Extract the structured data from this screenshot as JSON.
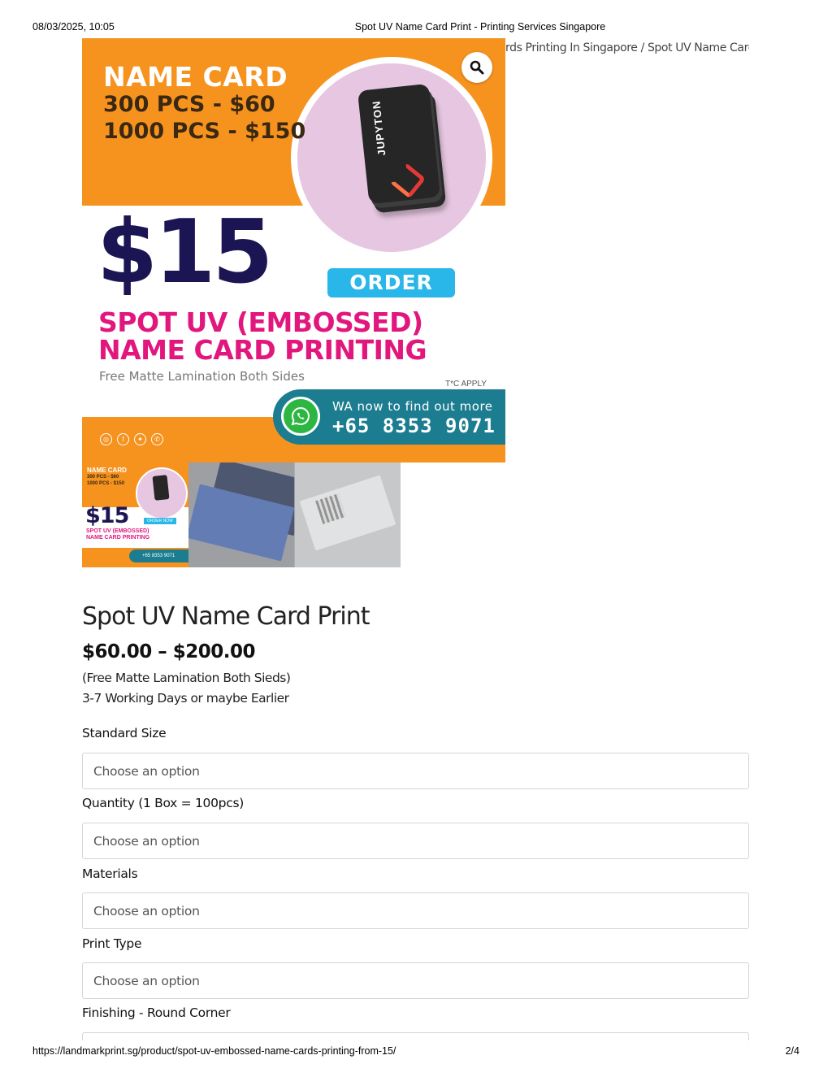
{
  "print_header": {
    "datetime": "08/03/2025, 10:05",
    "page_title": "Spot UV Name Card Print - Printing Services Singapore"
  },
  "breadcrumb": {
    "text": "rds Printing In Singapore / Spot UV Name Card"
  },
  "banner": {
    "title": "NAME CARD",
    "line1": "300 PCS - $60",
    "line2": "1000 PCS - $150",
    "card_brand": "JUPYTON",
    "price": "$15",
    "order_label": "ORDER NOW",
    "spot_line1": "SPOT UV (EMBOSSED)",
    "spot_line2": "NAME CARD PRINTING",
    "free_text": "Free Matte Lamination Both Sides",
    "tc_text": "T*C APPLY",
    "wa_line1": "WA now to find out more",
    "wa_line2": "+65 8353 9071",
    "colors": {
      "orange": "#f6931f",
      "navy": "#1c1554",
      "magenta": "#e2177e",
      "cyan": "#29b6e8",
      "teal": "#1b7d8f"
    }
  },
  "thumbnail1": {
    "title": "NAME CARD",
    "line1": "300 PCS - $60",
    "line2": "1000 PCS - $150",
    "price": "$15",
    "order": "ORDER NOW",
    "spot1": "SPOT UV (EMBOSSED)",
    "spot2": "NAME CARD PRINTING",
    "wa": "+65 8353 9071"
  },
  "product": {
    "title": "Spot UV Name Card Print",
    "price_range": "$60.00 – $200.00",
    "note1": "(Free Matte Lamination Both Sieds)",
    "note2": "3-7 Working Days or maybe Earlier"
  },
  "options": [
    {
      "label": "Standard Size",
      "placeholder": "Choose an option"
    },
    {
      "label": "Quantity (1 Box = 100pcs)",
      "placeholder": "Choose an option"
    },
    {
      "label": "Materials",
      "placeholder": "Choose an option"
    },
    {
      "label": "Print Type",
      "placeholder": "Choose an option"
    },
    {
      "label": "Finishing - Round Corner",
      "placeholder": ""
    }
  ],
  "print_footer": {
    "url": "https://landmarkprint.sg/product/spot-uv-embossed-name-cards-printing-from-15/",
    "page": "2/4"
  }
}
